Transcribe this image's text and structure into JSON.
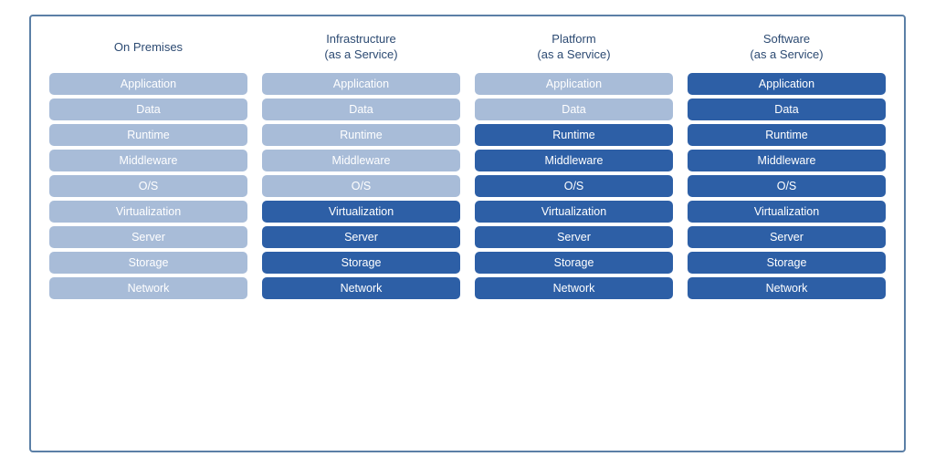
{
  "columns": [
    {
      "id": "on-premises",
      "header": "On Premises",
      "rows": [
        {
          "label": "Application",
          "shade": "light"
        },
        {
          "label": "Data",
          "shade": "light"
        },
        {
          "label": "Runtime",
          "shade": "light"
        },
        {
          "label": "Middleware",
          "shade": "light"
        },
        {
          "label": "O/S",
          "shade": "light"
        },
        {
          "label": "Virtualization",
          "shade": "light"
        },
        {
          "label": "Server",
          "shade": "light"
        },
        {
          "label": "Storage",
          "shade": "light"
        },
        {
          "label": "Network",
          "shade": "light"
        }
      ]
    },
    {
      "id": "iaas",
      "header": "Infrastructure\n(as a Service)",
      "rows": [
        {
          "label": "Application",
          "shade": "light"
        },
        {
          "label": "Data",
          "shade": "light"
        },
        {
          "label": "Runtime",
          "shade": "light"
        },
        {
          "label": "Middleware",
          "shade": "light"
        },
        {
          "label": "O/S",
          "shade": "light"
        },
        {
          "label": "Virtualization",
          "shade": "dark"
        },
        {
          "label": "Server",
          "shade": "dark"
        },
        {
          "label": "Storage",
          "shade": "dark"
        },
        {
          "label": "Network",
          "shade": "dark"
        }
      ]
    },
    {
      "id": "paas",
      "header": "Platform\n(as a Service)",
      "rows": [
        {
          "label": "Application",
          "shade": "light"
        },
        {
          "label": "Data",
          "shade": "light"
        },
        {
          "label": "Runtime",
          "shade": "dark"
        },
        {
          "label": "Middleware",
          "shade": "dark"
        },
        {
          "label": "O/S",
          "shade": "dark"
        },
        {
          "label": "Virtualization",
          "shade": "dark"
        },
        {
          "label": "Server",
          "shade": "dark"
        },
        {
          "label": "Storage",
          "shade": "dark"
        },
        {
          "label": "Network",
          "shade": "dark"
        }
      ]
    },
    {
      "id": "saas",
      "header": "Software\n(as a Service)",
      "rows": [
        {
          "label": "Application",
          "shade": "dark"
        },
        {
          "label": "Data",
          "shade": "dark"
        },
        {
          "label": "Runtime",
          "shade": "dark"
        },
        {
          "label": "Middleware",
          "shade": "dark"
        },
        {
          "label": "O/S",
          "shade": "dark"
        },
        {
          "label": "Virtualization",
          "shade": "dark"
        },
        {
          "label": "Server",
          "shade": "dark"
        },
        {
          "label": "Storage",
          "shade": "dark"
        },
        {
          "label": "Network",
          "shade": "dark"
        }
      ]
    }
  ]
}
